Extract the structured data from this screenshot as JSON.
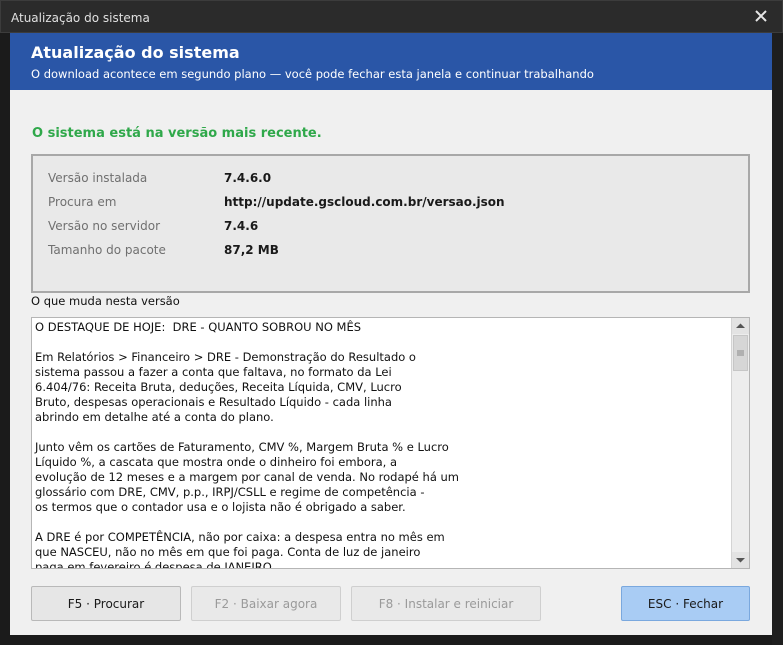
{
  "window": {
    "title": "Atualização do sistema"
  },
  "banner": {
    "title": "Atualização do sistema",
    "subtitle": "O download acontece em segundo plano — você pode fechar esta janela e continuar trabalhando"
  },
  "status_message": "O sistema está na versão mais recente.",
  "info": {
    "installed_label": "Versão instalada",
    "installed_value": "7.4.6.0",
    "source_label": "Procura em",
    "source_value": "http://update.gscloud.com.br/versao.json",
    "server_label": "Versão no servidor",
    "server_value": "7.4.6",
    "size_label": "Tamanho do pacote",
    "size_value": "87,2 MB"
  },
  "changes": {
    "label": "O que muda nesta versão",
    "text": "O DESTAQUE DE HOJE:  DRE - QUANTO SOBROU NO MÊS\n\nEm Relatórios > Financeiro > DRE - Demonstração do Resultado o\nsistema passou a fazer a conta que faltava, no formato da Lei\n6.404/76: Receita Bruta, deduções, Receita Líquida, CMV, Lucro\nBruto, despesas operacionais e Resultado Líquido - cada linha\nabrindo em detalhe até a conta do plano.\n\nJunto vêm os cartões de Faturamento, CMV %, Margem Bruta % e Lucro\nLíquido %, a cascata que mostra onde o dinheiro foi embora, a\nevolução de 12 meses e a margem por canal de venda. No rodapé há um\nglossário com DRE, CMV, p.p., IRPJ/CSLL e regime de competência -\nos termos que o contador usa e o lojista não é obrigado a saber.\n\nA DRE é por COMPETÊNCIA, não por caixa: a despesa entra no mês em\nque NASCEU, não no mês em que foi paga. Conta de luz de janeiro\npaga em fevereiro é despesa de JANEIRO."
  },
  "buttons": {
    "search": "F5 · Procurar",
    "download": "F2 · Baixar agora",
    "install": "F8 · Instalar e reiniciar",
    "close": "ESC · Fechar"
  },
  "colors": {
    "banner": "#2a56a7",
    "status_ok": "#2fa84a",
    "primary_button": "#a9ccf4"
  }
}
